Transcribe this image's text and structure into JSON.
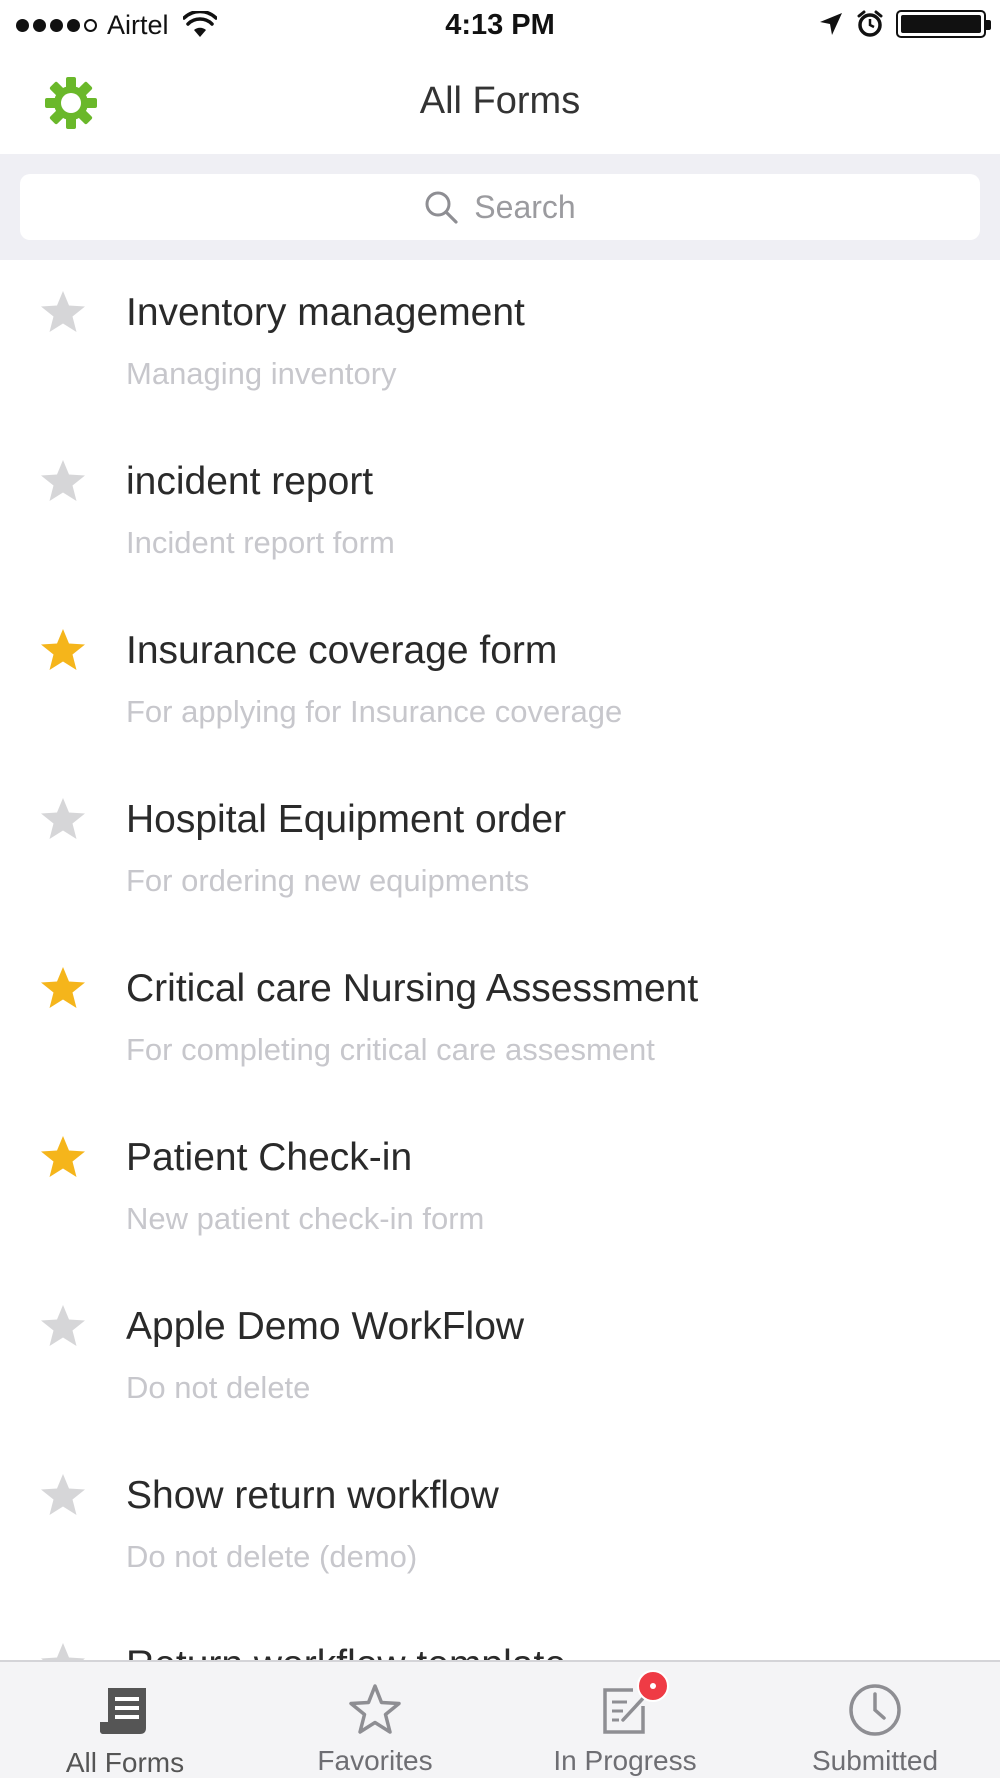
{
  "status_bar": {
    "carrier": "Airtel",
    "time": "4:13 PM",
    "signal_bars_filled": 4,
    "signal_bars_total": 5,
    "battery_level": 1.0
  },
  "nav": {
    "title": "All Forms",
    "settings_icon": "gear-icon",
    "accent_color": "#6ab82a"
  },
  "search": {
    "placeholder": "Search"
  },
  "colors": {
    "star_favorite": "#f5b51b",
    "star_default": "#d6d6d8",
    "badge": "#ef3b45"
  },
  "forms": [
    {
      "title": "Inventory management",
      "description": "Managing inventory",
      "favorite": false
    },
    {
      "title": "incident report",
      "description": "Incident report form",
      "favorite": false
    },
    {
      "title": "Insurance coverage form",
      "description": "For applying for Insurance coverage",
      "favorite": true
    },
    {
      "title": "Hospital Equipment order",
      "description": "For ordering new equipments",
      "favorite": false
    },
    {
      "title": "Critical care Nursing Assessment",
      "description": "For completing critical care assesment",
      "favorite": true
    },
    {
      "title": "Patient Check-in",
      "description": "New patient check-in form",
      "favorite": true
    },
    {
      "title": "Apple Demo WorkFlow",
      "description": "Do not delete",
      "favorite": false
    },
    {
      "title": "Show return workflow",
      "description": "Do not delete (demo)",
      "favorite": false
    },
    {
      "title": "Return workflow template",
      "description": "",
      "favorite": false
    }
  ],
  "tabs": [
    {
      "label": "All Forms",
      "icon": "forms-icon",
      "active": true
    },
    {
      "label": "Favorites",
      "icon": "star-icon",
      "active": false
    },
    {
      "label": "In Progress",
      "icon": "edit-icon",
      "active": false,
      "badge": true
    },
    {
      "label": "Submitted",
      "icon": "clock-icon",
      "active": false
    }
  ]
}
